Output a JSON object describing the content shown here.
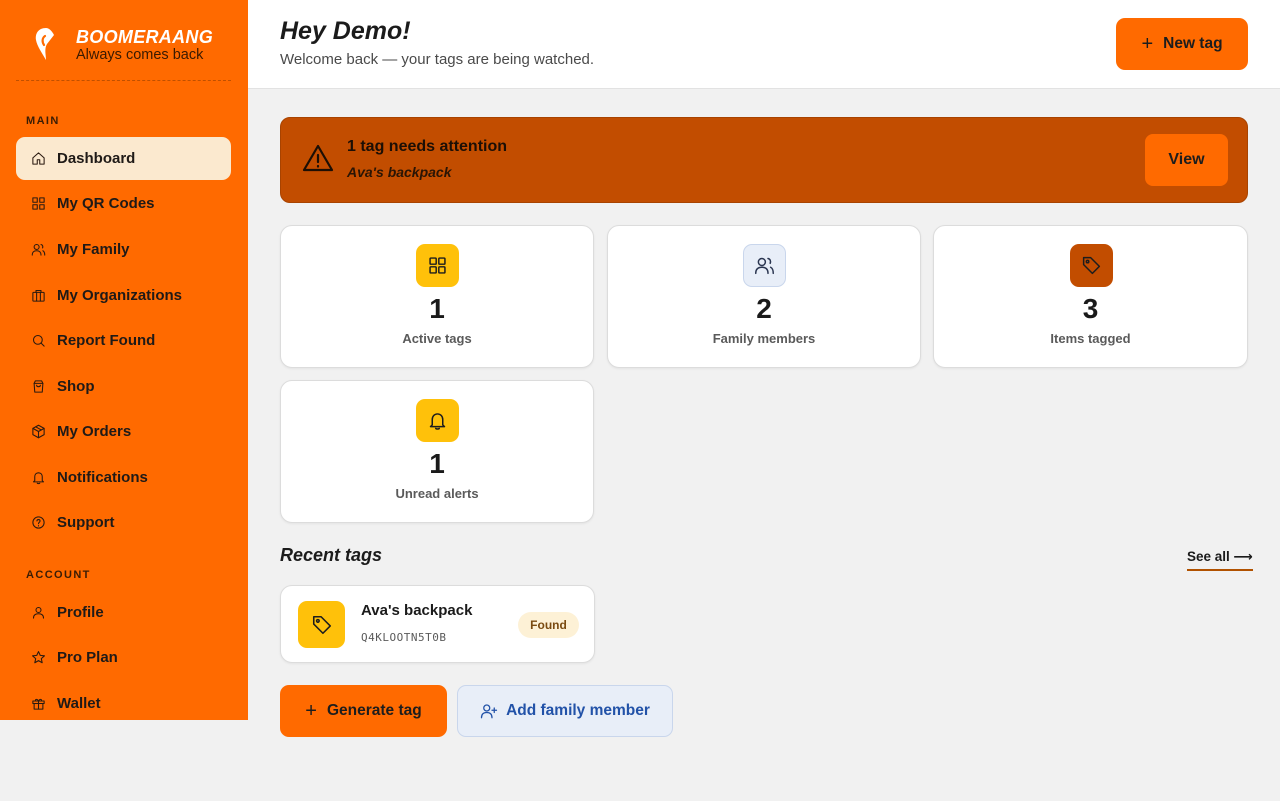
{
  "brand": {
    "name": "BOOMERAANG",
    "tagline": "Always comes back"
  },
  "sidebar": {
    "section_main": "MAIN",
    "section_account": "ACCOUNT",
    "main_items": [
      {
        "label": "Dashboard",
        "icon": "home-icon",
        "active": true
      },
      {
        "label": "My QR Codes",
        "icon": "grid-icon"
      },
      {
        "label": "My Family",
        "icon": "users-icon"
      },
      {
        "label": "My Organizations",
        "icon": "briefcase-icon"
      },
      {
        "label": "Report Found",
        "icon": "search-icon"
      },
      {
        "label": "Shop",
        "icon": "shopping-bag-icon"
      },
      {
        "label": "My Orders",
        "icon": "package-icon"
      },
      {
        "label": "Notifications",
        "icon": "bell-icon"
      },
      {
        "label": "Support",
        "icon": "help-circle-icon"
      }
    ],
    "account_items": [
      {
        "label": "Profile",
        "icon": "user-icon"
      },
      {
        "label": "Pro Plan",
        "icon": "star-icon"
      },
      {
        "label": "Wallet",
        "icon": "gift-icon"
      }
    ]
  },
  "header": {
    "greeting": "Hey Demo!",
    "welcome": "Welcome back — your tags are being watched.",
    "new_tag_label": "New tag"
  },
  "alert": {
    "title": "1 tag needs attention",
    "subtitle": "Ava's backpack",
    "button_label": "View"
  },
  "stats": [
    {
      "value": "1",
      "label": "Active tags",
      "icon": "grid-icon",
      "icon_bg": "#ffc10a"
    },
    {
      "value": "2",
      "label": "Family members",
      "icon": "users-icon",
      "icon_bg": "#e8eef8"
    },
    {
      "value": "3",
      "label": "Items tagged",
      "icon": "tag-icon",
      "icon_bg": "#c24d00"
    },
    {
      "value": "1",
      "label": "Unread alerts",
      "icon": "bell-icon",
      "icon_bg": "#ffc10a"
    }
  ],
  "recent": {
    "title": "Recent tags",
    "see_all": "See all ⟶",
    "tags": [
      {
        "name": "Ava's backpack",
        "code": "Q4KLOOTN5T0B",
        "status": "Found"
      }
    ]
  },
  "actions": {
    "generate_tag": "Generate tag",
    "add_family_member": "Add family member"
  },
  "colors": {
    "accent": "#ff6a00",
    "alert_bg": "#c24d00",
    "active_nav_bg": "#fbe9cf",
    "secondary_button_text": "#2252a8"
  }
}
